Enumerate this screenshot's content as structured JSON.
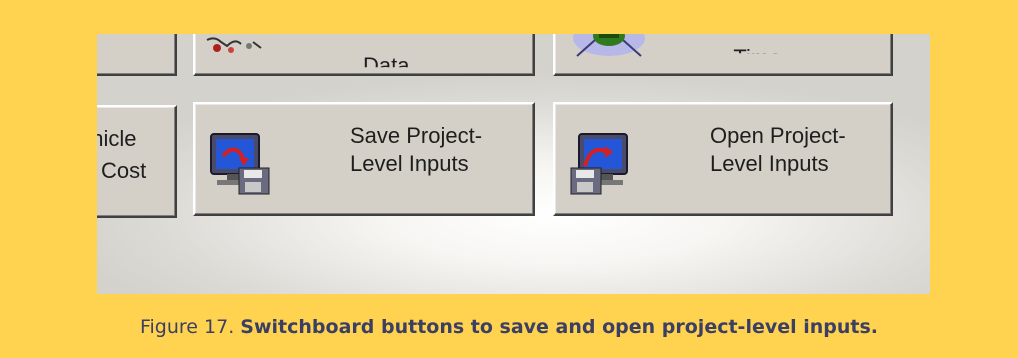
{
  "switchboard": {
    "top_row": {
      "middle_label": "Data",
      "right_label": "...Time"
    },
    "vehicle_cost": {
      "line1": "ehicle",
      "line2": "Cost"
    },
    "save_inputs": {
      "line1": "Save Project-",
      "line2": "Level Inputs"
    },
    "open_inputs": {
      "line1": "Open Project-",
      "line2": "Level Inputs"
    }
  },
  "caption": {
    "figure": "Figure 17.",
    "text": "Switchboard buttons to save and open project-level inputs."
  }
}
